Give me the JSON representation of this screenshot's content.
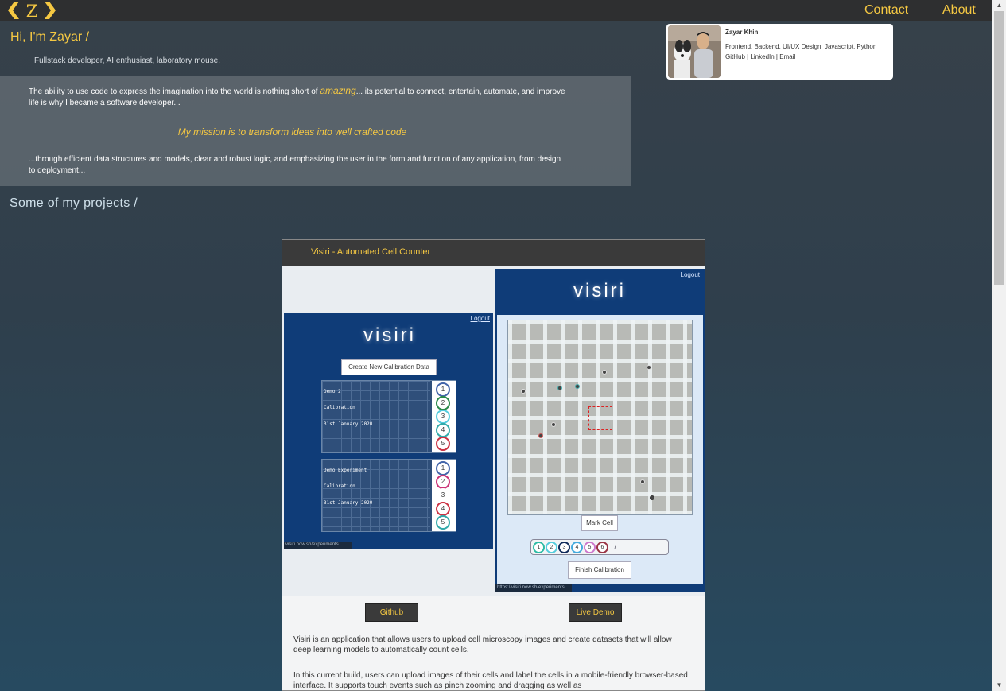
{
  "nav": {
    "logo_letter": "Z",
    "contact": "Contact",
    "about": "About"
  },
  "intro": {
    "title": "Hi, I'm Zayar /",
    "tagline": "Fullstack developer, AI enthusiast, laboratory mouse.",
    "p1_before": "The ability to use code to express the imagination into the world is nothing short of ",
    "p1_amazing": "amazing",
    "p1_after": "... its potential to connect, entertain, automate, and improve life is why I became a software developer...",
    "mission": "My mission is to transform ideas into well crafted code",
    "p2": "...through efficient data structures and models, clear and robust logic, and emphasizing the user in the form and function of any application, from design to deployment..."
  },
  "profile": {
    "name": "Zayar Khin",
    "skills": "Frontend, Backend, UI/UX Design, Javascript, Python",
    "links": [
      "GitHub",
      "LinkedIn",
      "Email"
    ]
  },
  "projects_title": "Some of my projects /",
  "project": {
    "title": "Visiri - Automated Cell Counter",
    "github_label": "Github",
    "demo_label": "Live Demo",
    "desc1": "Visiri is an application that allows users to upload cell microscopy images and create datasets that will allow deep learning models to automatically count cells.",
    "desc2": "In this current build, users can upload images of their cells and label the cells in a mobile-friendly browser-based interface. It supports touch events such as pinch zooming and dragging as well as"
  },
  "screens": {
    "logo": "visiri",
    "logout": "Logout",
    "create_btn": "Create New Calibration Data",
    "exp1": [
      "Demo 2",
      "Calibration",
      "31st January 2020"
    ],
    "exp2": [
      "Demo Experiment",
      "Calibration",
      "31st January 2020"
    ],
    "circles1": [
      "1",
      "2",
      "3",
      "4",
      "5"
    ],
    "circles2": [
      "1",
      "2",
      "3",
      "4",
      "5"
    ],
    "url_left": "visiri.now.sh/experiments",
    "url_right": "https://visiri.now.sh/experiments",
    "mark_cell": "Mark Cell",
    "finish": "Finish Calibration",
    "counter": [
      "1",
      "2",
      "3",
      "4",
      "5",
      "6",
      "7"
    ]
  },
  "colors": {
    "accent": "#f5c842",
    "nav_bg": "#2e2f30",
    "screen_blue": "#0f3c78"
  }
}
